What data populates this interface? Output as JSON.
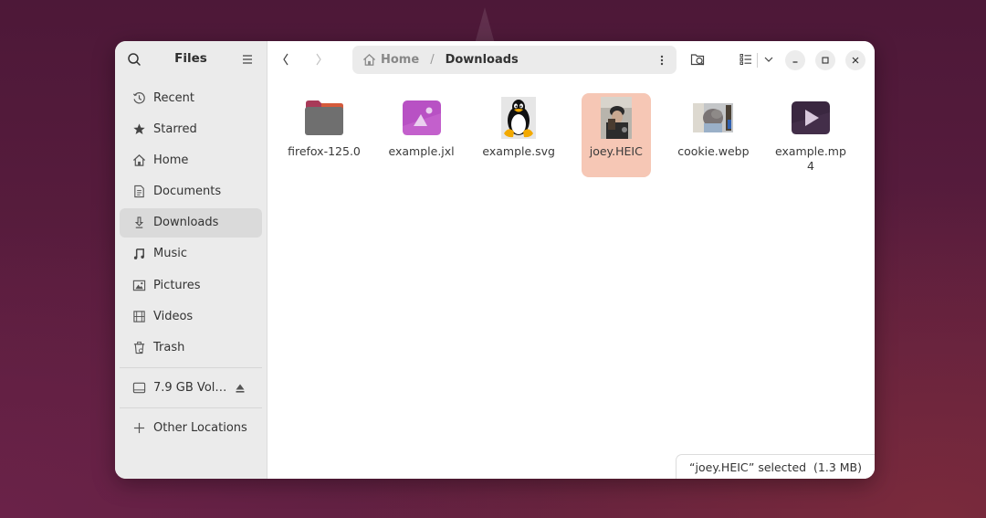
{
  "sidebar": {
    "title": "Files",
    "items": [
      {
        "label": "Recent",
        "icon": "clock-icon"
      },
      {
        "label": "Starred",
        "icon": "star-icon"
      },
      {
        "label": "Home",
        "icon": "home-icon"
      },
      {
        "label": "Documents",
        "icon": "document-icon"
      },
      {
        "label": "Downloads",
        "icon": "download-icon",
        "active": true
      },
      {
        "label": "Music",
        "icon": "music-icon"
      },
      {
        "label": "Pictures",
        "icon": "picture-icon"
      },
      {
        "label": "Videos",
        "icon": "film-icon"
      },
      {
        "label": "Trash",
        "icon": "trash-icon"
      }
    ],
    "volume": {
      "label": "7.9 GB Vol…",
      "icon": "drive-icon"
    },
    "other_locations": {
      "label": "Other Locations",
      "icon": "plus-icon"
    }
  },
  "pathbar": {
    "home_label": "Home",
    "separator": "/",
    "current": "Downloads"
  },
  "files": [
    {
      "name": "firefox-125.0",
      "type": "folder"
    },
    {
      "name": "example.jxl",
      "type": "image"
    },
    {
      "name": "example.svg",
      "type": "svg"
    },
    {
      "name": "joey.HEIC",
      "type": "photo",
      "selected": true
    },
    {
      "name": "cookie.webp",
      "type": "photo"
    },
    {
      "name": "example.mp4",
      "type": "video"
    }
  ],
  "status": {
    "text": "“joey.HEIC” selected  (1.3 MB)"
  },
  "colors": {
    "selection": "#f6c7b5",
    "sidebar_bg": "#ebebeb",
    "active_item": "#dadada"
  }
}
